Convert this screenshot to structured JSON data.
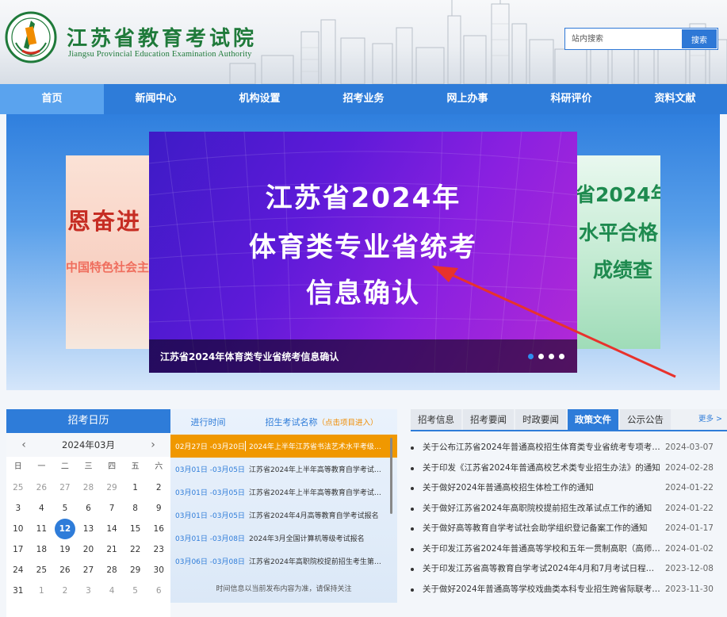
{
  "header": {
    "title": "江苏省教育考试院",
    "subtitle": "Jiangsu Provincial Education Examination Authority",
    "search_placeholder": "站内搜索",
    "search_button": "搜索"
  },
  "nav": {
    "items": [
      {
        "label": "首页",
        "active": true
      },
      {
        "label": "新闻中心"
      },
      {
        "label": "机构设置"
      },
      {
        "label": "招考业务"
      },
      {
        "label": "网上办事"
      },
      {
        "label": "科研评价"
      },
      {
        "label": "资料文献"
      }
    ]
  },
  "banner": {
    "main_lines": [
      "江苏省2024年",
      "体育类专业省统考",
      "信息确认"
    ],
    "caption": "江苏省2024年体育类专业省统考信息确认",
    "left_lines": [
      "恩奋进",
      "中国特色社会主"
    ],
    "right_lines": [
      "省2024年",
      "水平合格",
      "成绩查"
    ],
    "dot_count": 4,
    "active_dot": 0
  },
  "calendar": {
    "title": "招考日历",
    "month": "2024年03月",
    "prev": "‹",
    "next": "›",
    "weekdays": [
      "日",
      "一",
      "二",
      "三",
      "四",
      "五",
      "六"
    ],
    "days": [
      "25",
      "26",
      "27",
      "28",
      "29",
      "1",
      "2",
      "3",
      "4",
      "5",
      "6",
      "7",
      "8",
      "9",
      "10",
      "11",
      "12",
      "13",
      "14",
      "15",
      "16",
      "17",
      "18",
      "19",
      "20",
      "21",
      "22",
      "23",
      "24",
      "25",
      "26",
      "27",
      "28",
      "29",
      "30",
      "31",
      "1",
      "2",
      "3",
      "4",
      "5",
      "6"
    ],
    "today": "12"
  },
  "schedule": {
    "col_time": "进行时间",
    "col_name": "招生考试名称",
    "col_hint": "（点击项目进入）",
    "rows": [
      {
        "date": "02月27日 -03月20日",
        "name": "2024年上半年江苏省书法艺术水平考级报…",
        "active": true
      },
      {
        "date": "03月01日 -03月05日",
        "name": "江苏省2024年上半年高等教育自学考试免…"
      },
      {
        "date": "03月01日 -03月05日",
        "name": "江苏省2024年上半年高等教育自学考试省…"
      },
      {
        "date": "03月01日 -03月05日",
        "name": "江苏省2024年4月高等教育自学考试报名"
      },
      {
        "date": "03月01日 -03月08日",
        "name": "2024年3月全国计算机等级考试报名"
      },
      {
        "date": "03月06日 -03月08日",
        "name": "江苏省2024年高职院校提前招生考生第一…"
      }
    ],
    "note": "时间信息以当前发布内容为准，请保持关注"
  },
  "policy": {
    "tabs": [
      {
        "label": "招考信息"
      },
      {
        "label": "招考要闻"
      },
      {
        "label": "时政要闻"
      },
      {
        "label": "政策文件",
        "active": true
      },
      {
        "label": "公示公告"
      }
    ],
    "more": "更多 >",
    "items": [
      {
        "title": "关于公布江苏省2024年普通高校招生体育类专业省统考专项考…",
        "date": "2024-03-07"
      },
      {
        "title": "关于印发《江苏省2024年普通高校艺术类专业招生办法》的通知",
        "date": "2024-02-28"
      },
      {
        "title": "关于做好2024年普通高校招生体检工作的通知",
        "date": "2024-01-22"
      },
      {
        "title": "关于做好江苏省2024年高职院校提前招生改革试点工作的通知",
        "date": "2024-01-22"
      },
      {
        "title": "关于做好高等教育自学考试社会助学组织登记备案工作的通知",
        "date": "2024-01-17"
      },
      {
        "title": "关于印发江苏省2024年普通高等学校和五年一贯制高职（高师…",
        "date": "2024-01-02"
      },
      {
        "title": "关于印发江苏省高等教育自学考试2024年4月和7月考试日程表…",
        "date": "2023-12-08"
      },
      {
        "title": "关于做好2024年普通高等学校戏曲类本科专业招生跨省际联考工…",
        "date": "2023-11-30"
      }
    ]
  },
  "colors": {
    "nav_blue": "#2e7cd9",
    "nav_active": "#5aa3ee",
    "brand_green": "#1f7a3a",
    "schedule_active": "#f09800",
    "annotation_arrow": "#e8322c"
  },
  "icons": {
    "logo": "seal-logo",
    "search": "search-button",
    "arrow": "red-annotation-arrow"
  }
}
